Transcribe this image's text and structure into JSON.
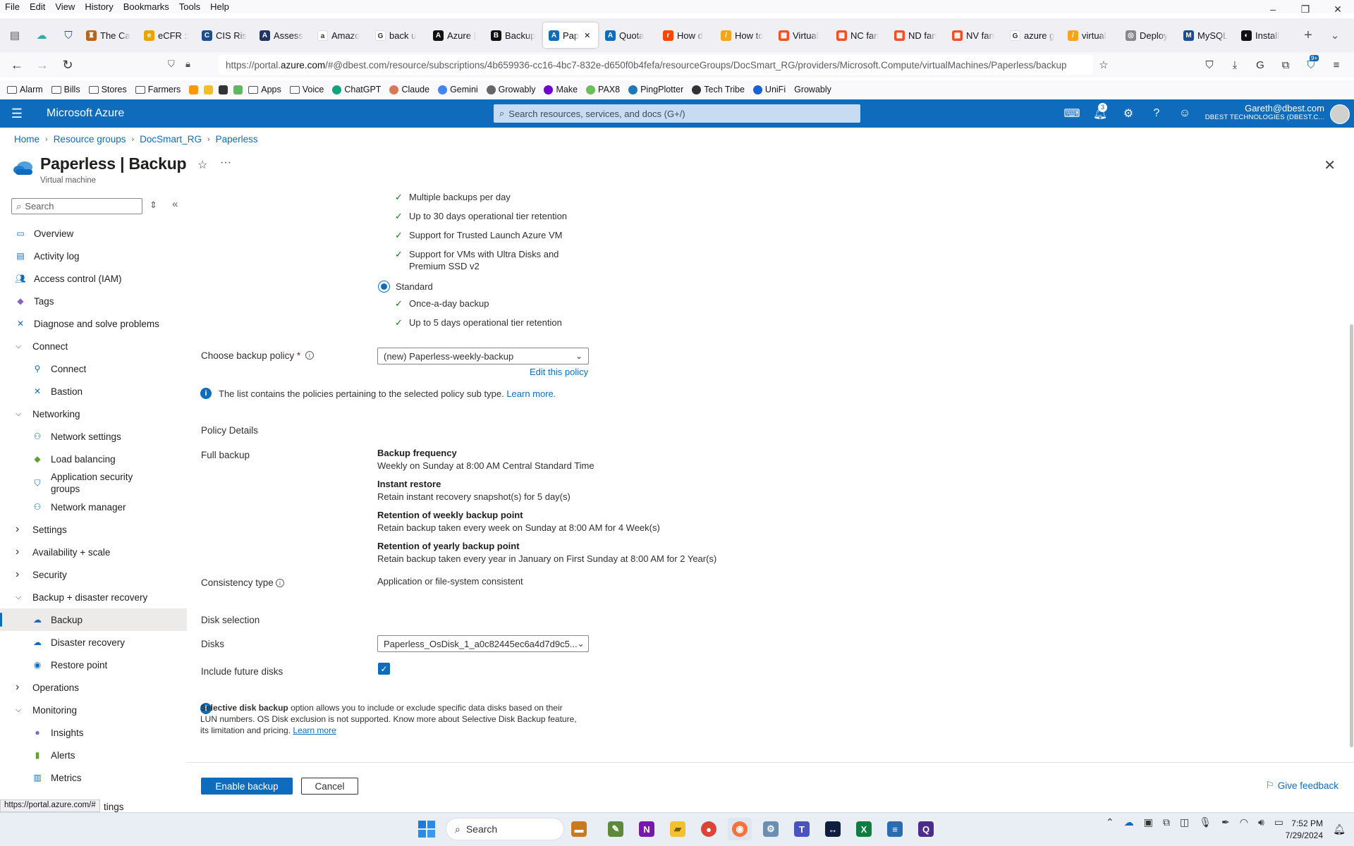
{
  "browser": {
    "menu": [
      "File",
      "Edit",
      "View",
      "History",
      "Bookmarks",
      "Tools",
      "Help"
    ],
    "tabs": [
      {
        "label": "The Ca",
        "color": "#b5651d",
        "glyph": "♜"
      },
      {
        "label": "eCFR ::",
        "color": "#e8a500",
        "glyph": "e"
      },
      {
        "label": "CIS Ris",
        "color": "#1f4e8c",
        "glyph": "C"
      },
      {
        "label": "Assess",
        "color": "#21335e",
        "glyph": "A"
      },
      {
        "label": "Amazo",
        "color": "#ffffff",
        "glyph": "a"
      },
      {
        "label": "back u",
        "color": "#ffffff",
        "glyph": "G"
      },
      {
        "label": "Azure |",
        "color": "#111111",
        "glyph": "A"
      },
      {
        "label": "Backup",
        "color": "#111111",
        "glyph": "B"
      },
      {
        "label": "Pap",
        "color": "#0f6cbd",
        "glyph": "A",
        "active": true
      },
      {
        "label": "Quota",
        "color": "#0f6cbd",
        "glyph": "A"
      },
      {
        "label": "How d",
        "color": "#ff4500",
        "glyph": "r"
      },
      {
        "label": "How to",
        "color": "#f7a41d",
        "glyph": "/"
      },
      {
        "label": "Virtual",
        "color": "#f25022",
        "glyph": "▦"
      },
      {
        "label": "NC fan",
        "color": "#f25022",
        "glyph": "▦"
      },
      {
        "label": "ND fan",
        "color": "#f25022",
        "glyph": "▦"
      },
      {
        "label": "NV fan",
        "color": "#f25022",
        "glyph": "▦"
      },
      {
        "label": "azure g",
        "color": "#ffffff",
        "glyph": "G"
      },
      {
        "label": "virtual",
        "color": "#f7a41d",
        "glyph": "/"
      },
      {
        "label": "Deploy",
        "color": "#888888",
        "glyph": "◎"
      },
      {
        "label": "MySQL",
        "color": "#1f4e8c",
        "glyph": "M"
      },
      {
        "label": "Install",
        "color": "#111111",
        "glyph": "◐"
      }
    ],
    "url_prefix": "https://portal.",
    "url_domain": "azure.com",
    "url_rest": "/#@dbest.com/resource/subscriptions/4b659936-cc16-4bc7-832e-d650f0b4fefa/resourceGroups/DocSmart_RG/providers/Microsoft.Compute/virtualMachines/Paperless/backup",
    "bookmarks": [
      "Alarm",
      "Bills",
      "Stores",
      "Farmers",
      "Apps",
      "Voice",
      "ChatGPT",
      "Claude",
      "Gemini",
      "Growably",
      "Make",
      "PAX8",
      "PingPlotter",
      "Tech Tribe",
      "UniFi",
      "Growably"
    ],
    "ext_badge": "9+",
    "status_url": "https://portal.azure.com/#"
  },
  "azure": {
    "brand": "Microsoft Azure",
    "search_placeholder": "Search resources, services, and docs (G+/)",
    "notifications": "3",
    "user": "Gareth@dbest.com",
    "org": "DBEST TECHNOLOGIES (DBEST.C..."
  },
  "breadcrumb": [
    "Home",
    "Resource groups",
    "DocSmart_RG",
    "Paperless"
  ],
  "page": {
    "title": "Paperless | Backup",
    "subtitle": "Virtual machine"
  },
  "sidenav": {
    "search_placeholder": "Search",
    "items": [
      {
        "label": "Overview",
        "type": "l0",
        "icon": "monitor-icon",
        "color": "#0f6cbd"
      },
      {
        "label": "Activity log",
        "type": "l0",
        "icon": "log-icon",
        "color": "#0f6cbd"
      },
      {
        "label": "Access control (IAM)",
        "type": "l0",
        "icon": "people-icon",
        "color": "#0f6cbd"
      },
      {
        "label": "Tags",
        "type": "l0",
        "icon": "tag-icon",
        "color": "#8661c5"
      },
      {
        "label": "Diagnose and solve problems",
        "type": "l0",
        "icon": "wrench-icon",
        "color": "#0f6cbd"
      },
      {
        "label": "Connect",
        "type": "group",
        "open": true
      },
      {
        "label": "Connect",
        "type": "l1",
        "icon": "plug-icon",
        "color": "#0f6cbd"
      },
      {
        "label": "Bastion",
        "type": "l1",
        "icon": "bastion-icon",
        "color": "#0f6cbd"
      },
      {
        "label": "Networking",
        "type": "group",
        "open": true
      },
      {
        "label": "Network settings",
        "type": "l1",
        "icon": "network-icon",
        "color": "#0f6cbd"
      },
      {
        "label": "Load balancing",
        "type": "l1",
        "icon": "diamond-icon",
        "color": "#5ea12d"
      },
      {
        "label": "Application security groups",
        "type": "l1",
        "icon": "shield-icon",
        "color": "#0f6cbd"
      },
      {
        "label": "Network manager",
        "type": "l1",
        "icon": "network-icon",
        "color": "#0f6cbd"
      },
      {
        "label": "Settings",
        "type": "group",
        "open": false
      },
      {
        "label": "Availability + scale",
        "type": "group",
        "open": false
      },
      {
        "label": "Security",
        "type": "group",
        "open": false
      },
      {
        "label": "Backup + disaster recovery",
        "type": "group",
        "open": true
      },
      {
        "label": "Backup",
        "type": "l1",
        "icon": "cloud-icon",
        "color": "#0f6cbd",
        "selected": true
      },
      {
        "label": "Disaster recovery",
        "type": "l1",
        "icon": "cloud-icon",
        "color": "#0f6cbd"
      },
      {
        "label": "Restore point",
        "type": "l1",
        "icon": "restore-icon",
        "color": "#0f6cbd"
      },
      {
        "label": "Operations",
        "type": "group",
        "open": false
      },
      {
        "label": "Monitoring",
        "type": "group",
        "open": true
      },
      {
        "label": "Insights",
        "type": "l1",
        "icon": "bulb-icon",
        "color": "#8661c5"
      },
      {
        "label": "Alerts",
        "type": "l1",
        "icon": "alert-icon",
        "color": "#5ea12d"
      },
      {
        "label": "Metrics",
        "type": "l1",
        "icon": "chart-icon",
        "color": "#0f6cbd"
      }
    ],
    "cut_label": "tings"
  },
  "form": {
    "enhanced_features": [
      "Multiple backups per day",
      "Up to 30 days operational tier retention",
      "Support for Trusted Launch Azure VM",
      "Support for VMs with Ultra Disks and Premium SSD v2"
    ],
    "standard_label": "Standard",
    "standard_features": [
      "Once-a-day backup",
      "Up to 5 days operational tier retention"
    ],
    "policy_label": "Choose backup policy",
    "policy_required": "*",
    "policy_value": "(new) Paperless-weekly-backup",
    "edit_policy": "Edit this policy",
    "policy_info": "The list contains the policies pertaining to the selected policy sub type.",
    "learn_more": "Learn more.",
    "policy_details_heading": "Policy Details",
    "full_backup_label": "Full backup",
    "details": [
      {
        "title": "Backup frequency",
        "text": "Weekly on Sunday at 8:00 AM Central Standard Time"
      },
      {
        "title": "Instant restore",
        "text": "Retain instant recovery snapshot(s) for 5 day(s)"
      },
      {
        "title": "Retention of weekly backup point",
        "text": "Retain backup taken every week on Sunday at 8:00 AM for 4 Week(s)"
      },
      {
        "title": "Retention of yearly backup point",
        "text": "Retain backup taken every year in January on First Sunday at 8:00 AM for 2 Year(s)"
      }
    ],
    "consistency_label": "Consistency type",
    "consistency_value": "Application or file-system consistent",
    "disk_heading": "Disk selection",
    "disks_label": "Disks",
    "disks_value": "Paperless_OsDisk_1_a0c82445ec6a4d7d9c5...",
    "future_disks_label": "Include future disks",
    "selective_bold": "Selective disk backup",
    "selective_text": " option allows you to include or exclude specific data disks based on their LUN numbers. OS Disk exclusion is not supported. Know more about Selective Disk Backup feature, its limitation and pricing. ",
    "selective_link": "Learn more",
    "enable_button": "Enable backup",
    "cancel_button": "Cancel",
    "feedback": "Give feedback"
  },
  "taskbar": {
    "search": "Search",
    "time": "7:52 PM",
    "date": "7/29/2024"
  }
}
